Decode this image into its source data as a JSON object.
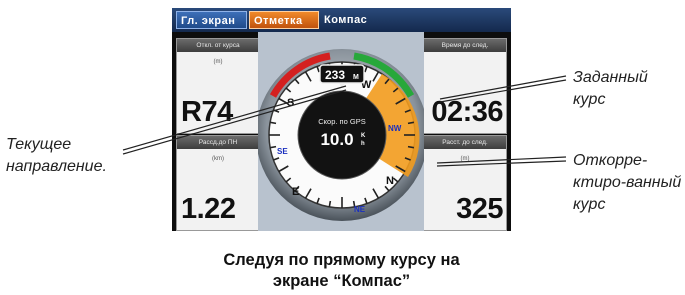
{
  "tabs": [
    {
      "label": "Гл. экран",
      "active": false
    },
    {
      "label": "Отметка",
      "active": true
    },
    {
      "label": "Компас",
      "active": false
    }
  ],
  "panels": {
    "top_left": {
      "header": "Откл. от курса",
      "unit": "(m)",
      "value": "R74"
    },
    "bottom_left": {
      "header": "Рассд.до ПН",
      "unit": "(km)",
      "value": "1.22"
    },
    "top_right": {
      "header": "Время до след.",
      "unit": "",
      "value": "02:36"
    },
    "bottom_right": {
      "header": "Расст. до след.",
      "unit": "(m)",
      "value": "325"
    }
  },
  "compass": {
    "heading_value": "233",
    "heading_unit": "M",
    "speed_label": "Скор. по GPS",
    "speed_value": "10.0",
    "speed_unit_top": "K",
    "speed_unit_bottom": "h",
    "cardinals": {
      "w": "W",
      "nw": "NW",
      "n": "N",
      "ne": "NE",
      "e": "E",
      "se": "SE",
      "s": "S"
    },
    "colors": {
      "desired_course": "#f29b1d",
      "red_arc": "#d42020",
      "green_arc": "#27a83a"
    }
  },
  "callouts": {
    "current_heading": [
      "Текущее",
      "направление."
    ],
    "desired_course": [
      "Заданный",
      "курс"
    ],
    "corrected_course": [
      "Откорре-",
      "ктиро-ванный",
      "курс"
    ]
  },
  "caption": [
    "Следуя по прямому курсу на",
    "экране “Компас”"
  ]
}
